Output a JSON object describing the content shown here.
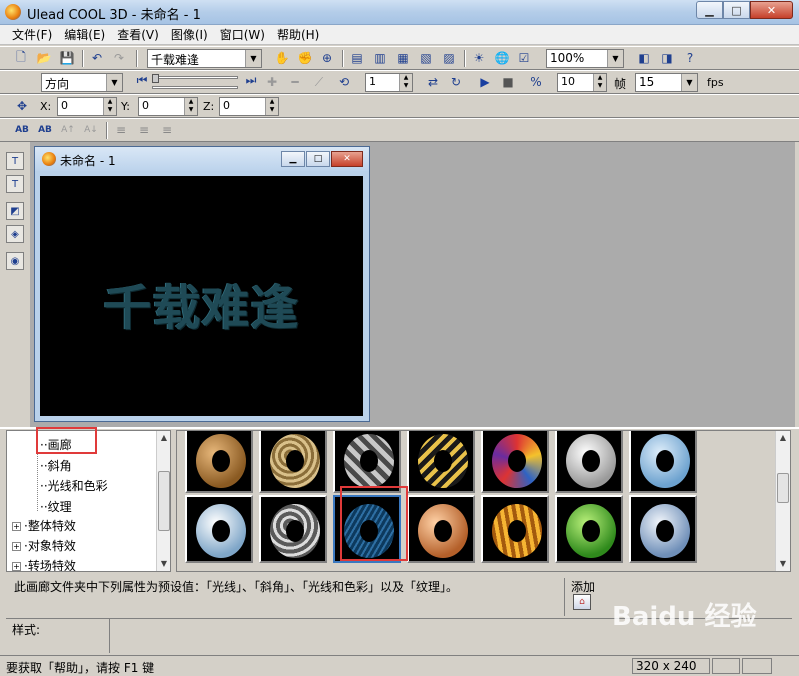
{
  "window": {
    "title": "Ulead COOL 3D - 未命名 - 1"
  },
  "menu": [
    "文件(F)",
    "编辑(E)",
    "查看(V)",
    "图像(I)",
    "窗口(W)",
    "帮助(H)"
  ],
  "toolbar1": {
    "text_select": "千载难逢",
    "zoom": "100%"
  },
  "toolbar2": {
    "direction": "方向",
    "frame": "1",
    "speed": "10",
    "frame_label": "帧",
    "fps_value": "15",
    "fps_label": "fps"
  },
  "toolbar3": {
    "x_label": "X:",
    "x_value": "0",
    "y_label": "Y:",
    "y_value": "0",
    "z_label": "Z:",
    "z_value": "0"
  },
  "document": {
    "title": "未命名 - 1",
    "canvas_text": "千载难逢"
  },
  "tree": {
    "items": [
      {
        "label": "画廊",
        "selected": true
      },
      {
        "label": "斜角"
      },
      {
        "label": "光线和色彩"
      },
      {
        "label": "纹理"
      },
      {
        "label": "整体特效"
      },
      {
        "label": "对象特效"
      },
      {
        "label": "转场特效"
      }
    ]
  },
  "gallery": {
    "selected_index": 9,
    "rows": [
      [
        "bronze",
        "bronze-dots",
        "silver-checker",
        "gold-dots",
        "stained-glass",
        "white-silver",
        "sky-blue"
      ],
      [
        "white-blue",
        "chrome-dots",
        "blue-texture",
        "copper",
        "gold-stripes",
        "green",
        "ice-blue"
      ]
    ]
  },
  "panel": {
    "description": "此画廊文件夹中下列属性为预设值：「光线」、「斜角」、「光线和色彩」以及「纹理」。",
    "add_label": "添加",
    "style_label": "样式:"
  },
  "status": {
    "help_text": "要获取「帮助」，请按 F1 键",
    "resolution": "320 x 240"
  },
  "watermark": "Baidu 经验",
  "colors": {
    "highlight": "#e03a3a",
    "canvas_bg": "#000000",
    "workspace": "#ababab"
  }
}
